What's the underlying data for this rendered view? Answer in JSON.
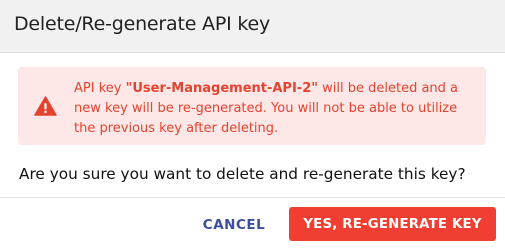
{
  "dialog": {
    "title": "Delete/Re-generate API key",
    "alert": {
      "text_prefix": "API key ",
      "key_name": "\"User-Management-API-2\"",
      "text_suffix": " will be deleted and a new key will be re-generated. You will not be able to utilize the previous key after deleting.",
      "icon": "warning-icon",
      "color": "#e5432f",
      "background": "#fde7e7"
    },
    "question": "Are you sure you want to delete and re-generate this key?",
    "actions": {
      "cancel_label": "CANCEL",
      "confirm_label": "YES, RE-GENERATE KEY"
    }
  },
  "colors": {
    "header_bg": "#f1f1f1",
    "primary": "#f03e33",
    "cancel_text": "#3b4f9c"
  }
}
